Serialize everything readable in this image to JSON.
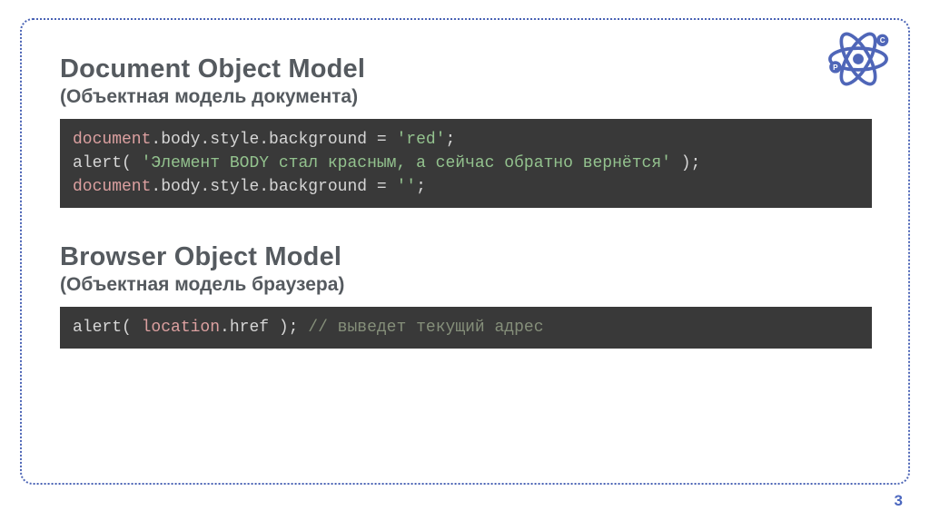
{
  "section1": {
    "heading": "Document Object Model",
    "subheading": "(Объектная модель документа)",
    "code": {
      "line1_obj": "document",
      "line1_rest": ".body.style.background = ",
      "line1_str": "'red'",
      "line1_end": ";",
      "line2_fn": "alert",
      "line2_open": "( ",
      "line2_str": "'Элемент BODY стал красным, а сейчас обратно вернётся'",
      "line2_close": " );",
      "line3_obj": "document",
      "line3_rest": ".body.style.background = ",
      "line3_str": "''",
      "line3_end": ";"
    }
  },
  "section2": {
    "heading": "Browser Object Model",
    "subheading": "(Объектная модель браузера)",
    "code": {
      "line1_fn": "alert",
      "line1_open": "( ",
      "line1_arg": "location",
      "line1_rest": ".href );",
      "line1_com": " // выведет текущий адрес"
    }
  },
  "pageNumber": "3"
}
